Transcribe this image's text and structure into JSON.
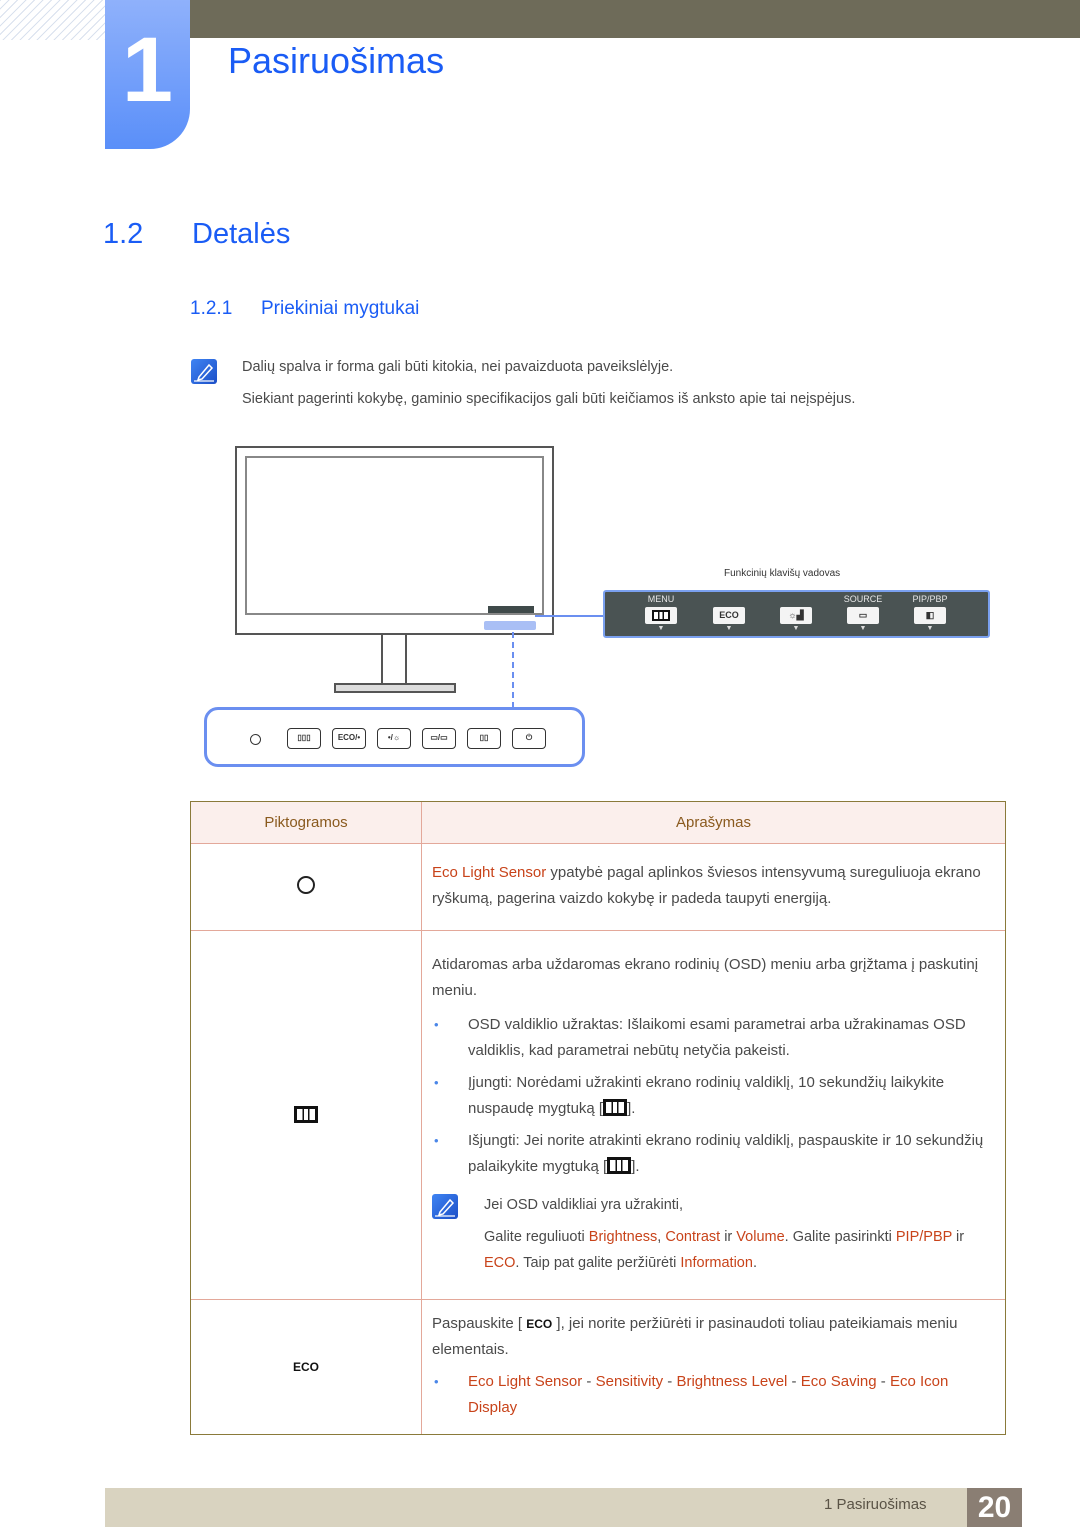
{
  "header": {
    "chapter_number": "1",
    "chapter_title": "Pasiruošimas"
  },
  "section": {
    "number": "1.2",
    "title": "Detalės"
  },
  "subsection": {
    "number": "1.2.1",
    "title": "Priekiniai mygtukai"
  },
  "notes": [
    "Dalių spalva ir forma gali būti kitokia, nei pavaizduota paveikslėlyje.",
    "Siekiant pagerinti kokybę, gaminio specifikacijos gali būti keičiamos iš anksto apie tai neįspėjus."
  ],
  "figure": {
    "function_key_guide_label": "Funkcinių klavišų vadovas",
    "function_keys": [
      {
        "label": "MENU",
        "key": "menu-icon"
      },
      {
        "label": "",
        "key": "ECO"
      },
      {
        "label": "",
        "key": "brightness-icon"
      },
      {
        "label": "SOURCE",
        "key": "source-icon"
      },
      {
        "label": "PIP/PBP",
        "key": "pip-icon"
      }
    ],
    "front_buttons": [
      "",
      "ECO/•",
      "•/☼",
      "▭/▭",
      "▯▯",
      "⏻"
    ]
  },
  "table": {
    "headers": [
      "Piktogramos",
      "Aprašymas"
    ],
    "rows": {
      "sensor": {
        "hl": "Eco Light Sensor",
        "text": " ypatybė pagal aplinkos šviesos intensyvumą sureguliuoja ekrano ryškumą, pagerina vaizdo kokybę ir padeda taupyti energiją."
      },
      "menu": {
        "intro": "Atidaromas arba uždaromas ekrano rodinių (OSD) meniu arba grįžtama į paskutinį meniu.",
        "b1": "OSD valdiklio užraktas: Išlaikomi esami parametrai arba užrakinamas OSD valdiklis, kad parametrai nebūtų netyčia pakeisti.",
        "b2_pre": "Įjungti: Norėdami užrakinti ekrano rodinių valdiklį, 10 sekundžių laikykite nuspaudę mygtuką [",
        "b2_post": "].",
        "b3_pre": "Išjungti: Jei norite atrakinti ekrano rodinių valdiklį, paspauskite ir 10 sekundžių palaikykite mygtuką [",
        "b3_post": "].",
        "note1": "Jei OSD valdikliai yra užrakinti,",
        "n_t1": "Galite reguliuoti ",
        "n_h1": "Brightness",
        "n_t2": ", ",
        "n_h2": "Contrast",
        "n_t3": " ir ",
        "n_h3": "Volume",
        "n_t4": ". Galite pasirinkti ",
        "n_h4": "PIP/PBP",
        "n_t5": " ir ",
        "n_h5": "ECO",
        "n_t6": ". Taip pat galite peržiūrėti ",
        "n_h6": "Information",
        "n_t7": "."
      },
      "eco": {
        "icon_label": "ECO",
        "pre": "Paspauskite [ ",
        "key": "ECO",
        "post": " ], jei norite peržiūrėti ir pasinaudoti toliau pateikiamais meniu elementais.",
        "items": [
          "Eco Light Sensor",
          "Sensitivity",
          "Brightness Level",
          "Eco Saving",
          "Eco Icon Display"
        ],
        "sep": " - "
      }
    }
  },
  "footer": {
    "chapter": "1 Pasiruošimas",
    "page": "20"
  }
}
